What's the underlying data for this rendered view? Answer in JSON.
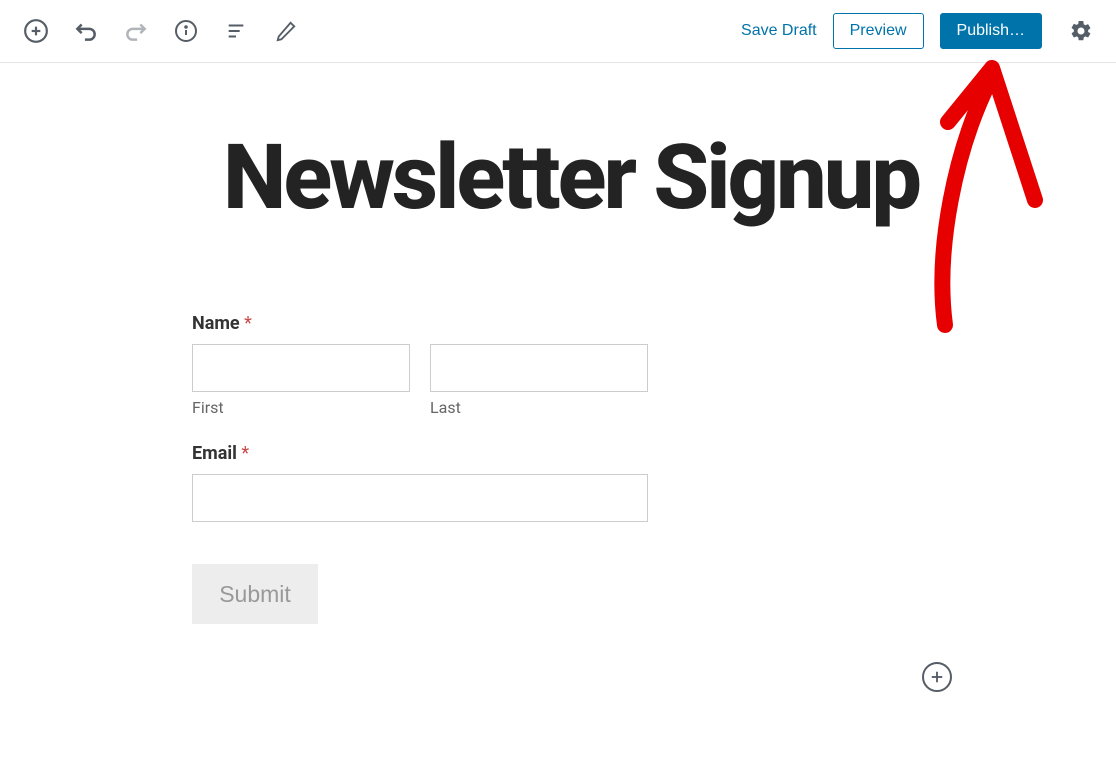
{
  "topbar": {
    "save_draft": "Save Draft",
    "preview": "Preview",
    "publish": "Publish…"
  },
  "post": {
    "title": "Newsletter Signup"
  },
  "form": {
    "name_label": "Name",
    "first_label": "First",
    "last_label": "Last",
    "email_label": "Email",
    "required_marker": "*",
    "submit_label": "Submit"
  }
}
